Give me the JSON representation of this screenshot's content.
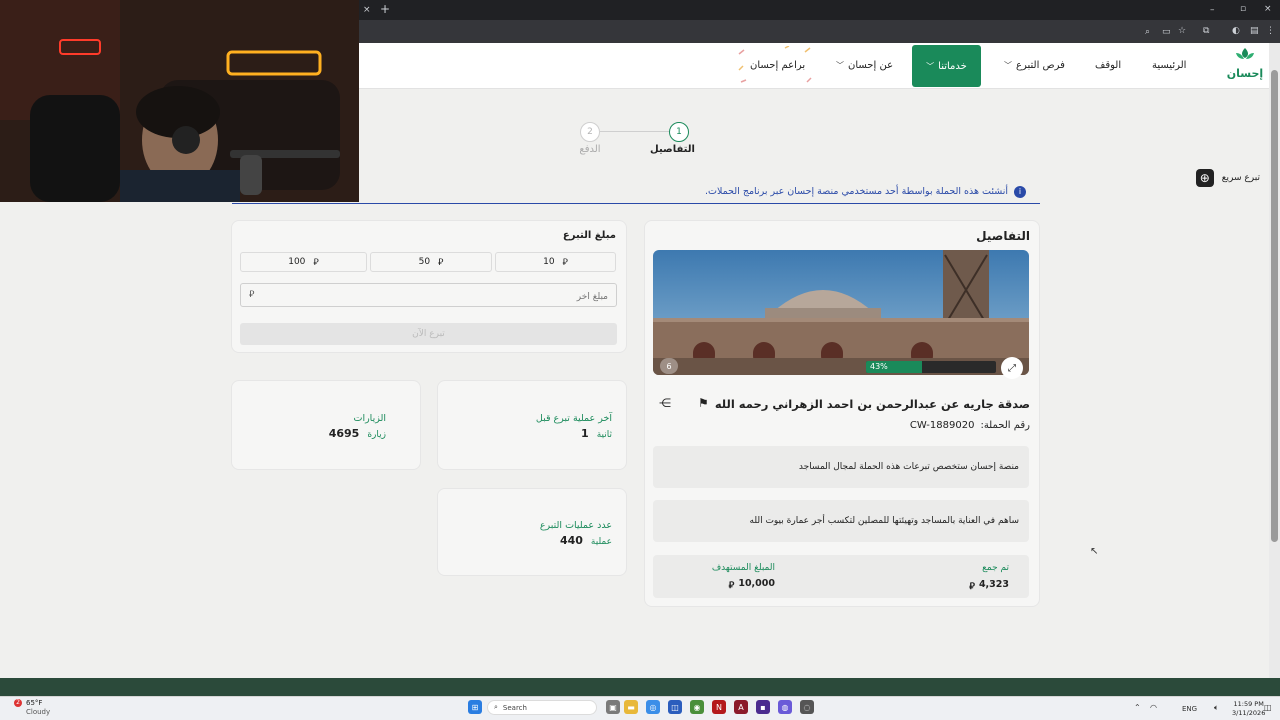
{
  "browser": {
    "new_tab": "+",
    "close_tab": "×",
    "window_controls": [
      "–",
      "▫",
      "×"
    ]
  },
  "nav": {
    "logo_text": "إحسان",
    "items": {
      "home": "الرئيسية",
      "waqf": "الوقف",
      "donation_opportunities": "فرص التبرع",
      "services": "خدماتنا",
      "about": "عن إحسان",
      "ihsan_programs": "براعم إحسان"
    }
  },
  "stepper": {
    "step1_number": "1",
    "step1_label": "التفاصيل",
    "step2_number": "2",
    "step2_label": "الدفع"
  },
  "quick_donate": {
    "label": "تبرع سريع",
    "icon": "plus-circle-icon"
  },
  "notice": {
    "text": "أنشئت هذه الحملة بواسطة أحد مستخدمي منصة إحسان عبر برنامج الحملات."
  },
  "donation": {
    "title": "مبلغ التبرع",
    "amounts": [
      "10",
      "50",
      "100"
    ],
    "currency_symbol": "⃁",
    "other_placeholder": "مبلغ آخر",
    "donate_now": "تبرع الآن"
  },
  "stats": {
    "visits_label": "الزيارات",
    "visits_value": "4695",
    "visits_unit": "زيارة",
    "last_donation_label": "آخر عملية تبرع قبل",
    "last_donation_value": "1",
    "last_donation_unit": "ثانية",
    "donations_count_label": "عدد عمليات التبرع",
    "donations_count_value": "440",
    "donations_count_unit": "عملية"
  },
  "details": {
    "title": "التفاصيل",
    "progress_percent": "43%",
    "progress_fraction": 0.43,
    "image_counter": "6",
    "campaign_title": "صدقة جاريه عن عبدالرحمن بن احمد الزهراني رحمه الله",
    "campaign_number_label": "رقم الحملة:",
    "campaign_number": "CW-1889020",
    "note": "منصة إحسان ستخصص تبرعات هذه الحملة لمجال المساجد",
    "description": "ساهم في العناية بالمساجد وتهيئتها للمصلين لتكسب أجر عمارة بيوت الله",
    "collected_label": "تم جمع",
    "collected_value": "4,323",
    "target_label": "المبلغ المستهدف",
    "target_value": "10,000"
  },
  "taskbar": {
    "weather_temp": "65°F",
    "weather_desc": "Cloudy",
    "weather_badge": "2",
    "search_placeholder": "Search",
    "language": "ENG",
    "time": "11:59 PM",
    "date": "3/11/2026"
  },
  "colors": {
    "brand": "#1a8a5a",
    "notice_text": "#2a4aa8"
  }
}
